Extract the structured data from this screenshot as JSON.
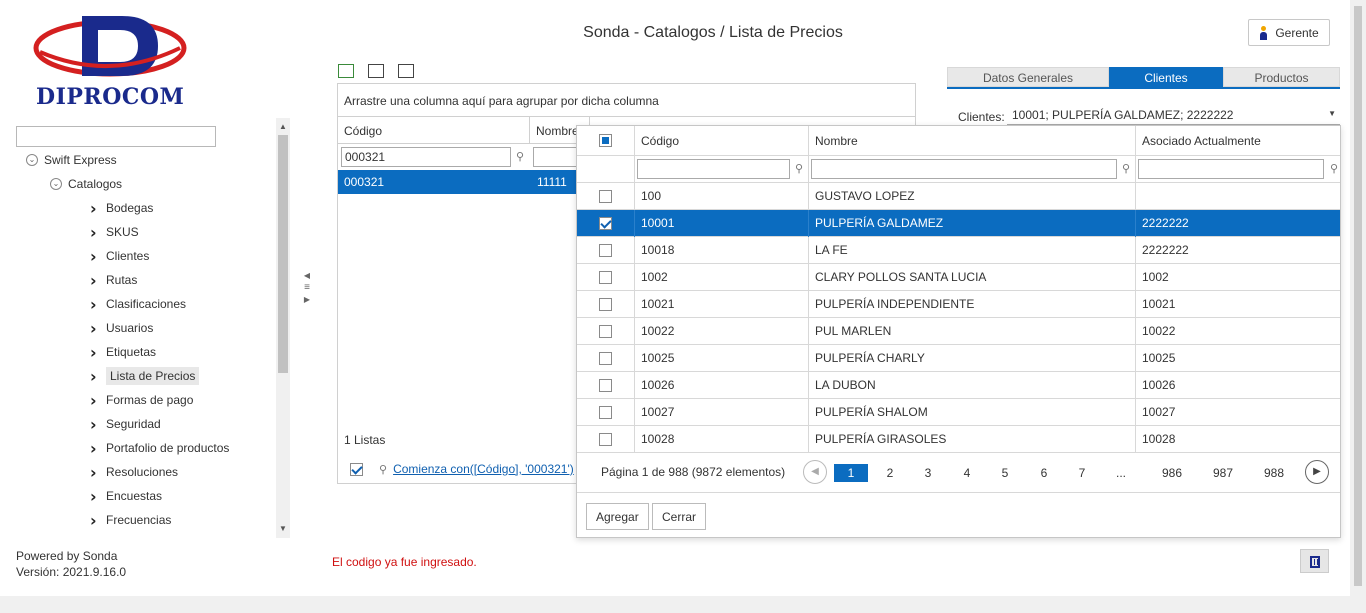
{
  "header": {
    "logo_text": "DIPROCOM",
    "title": "Sonda - Catalogos / Lista de Precios",
    "user_label": "Gerente"
  },
  "sidebar": {
    "root": "Swift Express",
    "section": "Catalogos",
    "items": [
      {
        "label": "Bodegas"
      },
      {
        "label": "SKUS"
      },
      {
        "label": "Clientes"
      },
      {
        "label": "Rutas"
      },
      {
        "label": "Clasificaciones"
      },
      {
        "label": "Usuarios"
      },
      {
        "label": "Etiquetas"
      },
      {
        "label": "Lista de Precios",
        "selected": true
      },
      {
        "label": "Formas de pago"
      },
      {
        "label": "Seguridad"
      },
      {
        "label": "Portafolio de productos"
      },
      {
        "label": "Resoluciones"
      },
      {
        "label": "Encuestas"
      },
      {
        "label": "Frecuencias"
      }
    ]
  },
  "main_grid": {
    "group_hint": "Arrastre una columna aquí para agrupar por dicha columna",
    "columns": [
      "Código",
      "Nombre"
    ],
    "filter_value": "000321",
    "row": {
      "codigo": "000321",
      "nombre": "11111"
    },
    "footer": "1 Listas",
    "filter_expression": "Comienza con([Código], '000321')"
  },
  "tabs": [
    "Datos Generales",
    "Clientes",
    "Productos"
  ],
  "active_tab": "Clientes",
  "clients": {
    "label": "Clientes:",
    "selected_value": "10001; PULPERÍA GALDAMEZ; 2222222"
  },
  "popup": {
    "columns": [
      "Código",
      "Nombre",
      "Asociado Actualmente"
    ],
    "rows": [
      {
        "codigo": "100",
        "nombre": "GUSTAVO LOPEZ",
        "asociado": "",
        "checked": false
      },
      {
        "codigo": "10001",
        "nombre": "PULPERÍA GALDAMEZ",
        "asociado": "2222222",
        "checked": true
      },
      {
        "codigo": "10018",
        "nombre": "LA FE",
        "asociado": "2222222",
        "checked": false
      },
      {
        "codigo": "1002",
        "nombre": "CLARY POLLOS SANTA LUCIA",
        "asociado": "1002",
        "checked": false
      },
      {
        "codigo": "10021",
        "nombre": "PULPERÍA INDEPENDIENTE",
        "asociado": "10021",
        "checked": false
      },
      {
        "codigo": "10022",
        "nombre": "PUL MARLEN",
        "asociado": "10022",
        "checked": false
      },
      {
        "codigo": "10025",
        "nombre": "PULPERÍA CHARLY",
        "asociado": "10025",
        "checked": false
      },
      {
        "codigo": "10026",
        "nombre": "LA DUBON",
        "asociado": "10026",
        "checked": false
      },
      {
        "codigo": "10027",
        "nombre": "PULPERÍA SHALOM",
        "asociado": "10027",
        "checked": false
      },
      {
        "codigo": "10028",
        "nombre": "PULPERÍA GIRASOLES",
        "asociado": "10028",
        "checked": false
      }
    ],
    "pager": {
      "info": "Página 1 de 988 (9872 elementos)",
      "pages": [
        "1",
        "2",
        "3",
        "4",
        "5",
        "6",
        "7",
        "...",
        "986",
        "987",
        "988"
      ],
      "current": "1"
    },
    "add_label": "Agregar",
    "close_label": "Cerrar"
  },
  "footer": {
    "powered": "Powered by Sonda",
    "version": "Versión: 2021.9.16.0",
    "error": "El codigo ya fue ingresado."
  },
  "colors": {
    "accent": "#0b6cc0",
    "error": "#d01010",
    "logo_blue": "#1a2a8c",
    "logo_red": "#d42020"
  }
}
